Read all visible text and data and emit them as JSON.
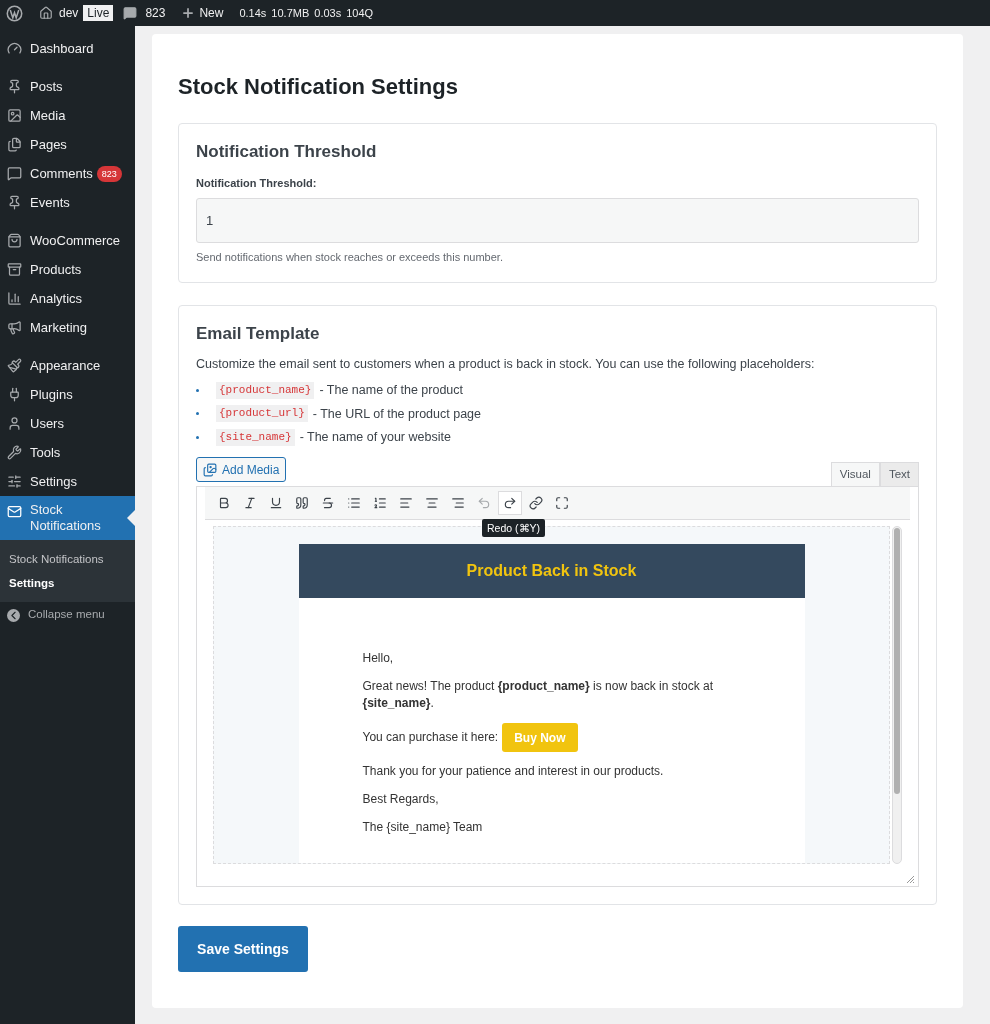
{
  "admin_bar": {
    "site": "dev",
    "env": "Live",
    "comments": "823",
    "new": "New",
    "stats": [
      "0.14s",
      "10.7MB",
      "0.03s",
      "104Q"
    ]
  },
  "sidebar": {
    "groups": [
      [
        {
          "label": "Dashboard",
          "selected": false
        }
      ],
      [
        {
          "label": "Posts",
          "selected": false
        },
        {
          "label": "Media",
          "selected": false
        },
        {
          "label": "Pages",
          "selected": false
        },
        {
          "label": "Comments",
          "selected": false,
          "badge": "823"
        },
        {
          "label": "Events",
          "selected": false
        }
      ],
      [
        {
          "label": "WooCommerce",
          "selected": false
        },
        {
          "label": "Products",
          "selected": false
        },
        {
          "label": "Analytics",
          "selected": false
        },
        {
          "label": "Marketing",
          "selected": false
        }
      ],
      [
        {
          "label": "Appearance",
          "selected": false
        },
        {
          "label": "Plugins",
          "selected": false
        },
        {
          "label": "Users",
          "selected": false
        },
        {
          "label": "Tools",
          "selected": false
        },
        {
          "label": "Settings",
          "selected": false
        },
        {
          "label": "Stock Notifications",
          "selected": true
        }
      ]
    ],
    "submenu": [
      {
        "label": "Stock Notifications",
        "selected": false
      },
      {
        "label": "Settings",
        "selected": true
      }
    ],
    "collapse": "Collapse menu"
  },
  "page": {
    "title": "Stock Notification Settings",
    "threshold": {
      "heading": "Notification Threshold",
      "label": "Notification Threshold:",
      "value": "1",
      "help": "Send notifications when stock reaches or exceeds this number."
    },
    "email": {
      "heading": "Email Template",
      "intro": "Customize the email sent to customers when a product is back in stock. You can use the following placeholders:",
      "placeholders": [
        {
          "code": "{product_name}",
          "desc": "- The name of the product"
        },
        {
          "code": "{product_url}",
          "desc": "- The URL of the product page"
        },
        {
          "code": "{site_name}",
          "desc": "- The name of your website"
        }
      ],
      "add_media": "Add Media",
      "tabs": [
        {
          "label": "Visual",
          "selected": true
        },
        {
          "label": "Text",
          "selected": false
        }
      ],
      "tooltip": "Redo (⌘Y)",
      "preview": {
        "header": "Product Back in Stock",
        "greeting": "Hello,",
        "news": "Great news! The product **{product_name}** is now back in stock at **{site_name}**.",
        "purchase": "You can purchase it here:",
        "button": "Buy Now",
        "thanks": "Thank you for your patience and interest in our products.",
        "regards": "Best Regards,",
        "signature": "The {site_name} Team"
      }
    },
    "save": "Save Settings"
  }
}
